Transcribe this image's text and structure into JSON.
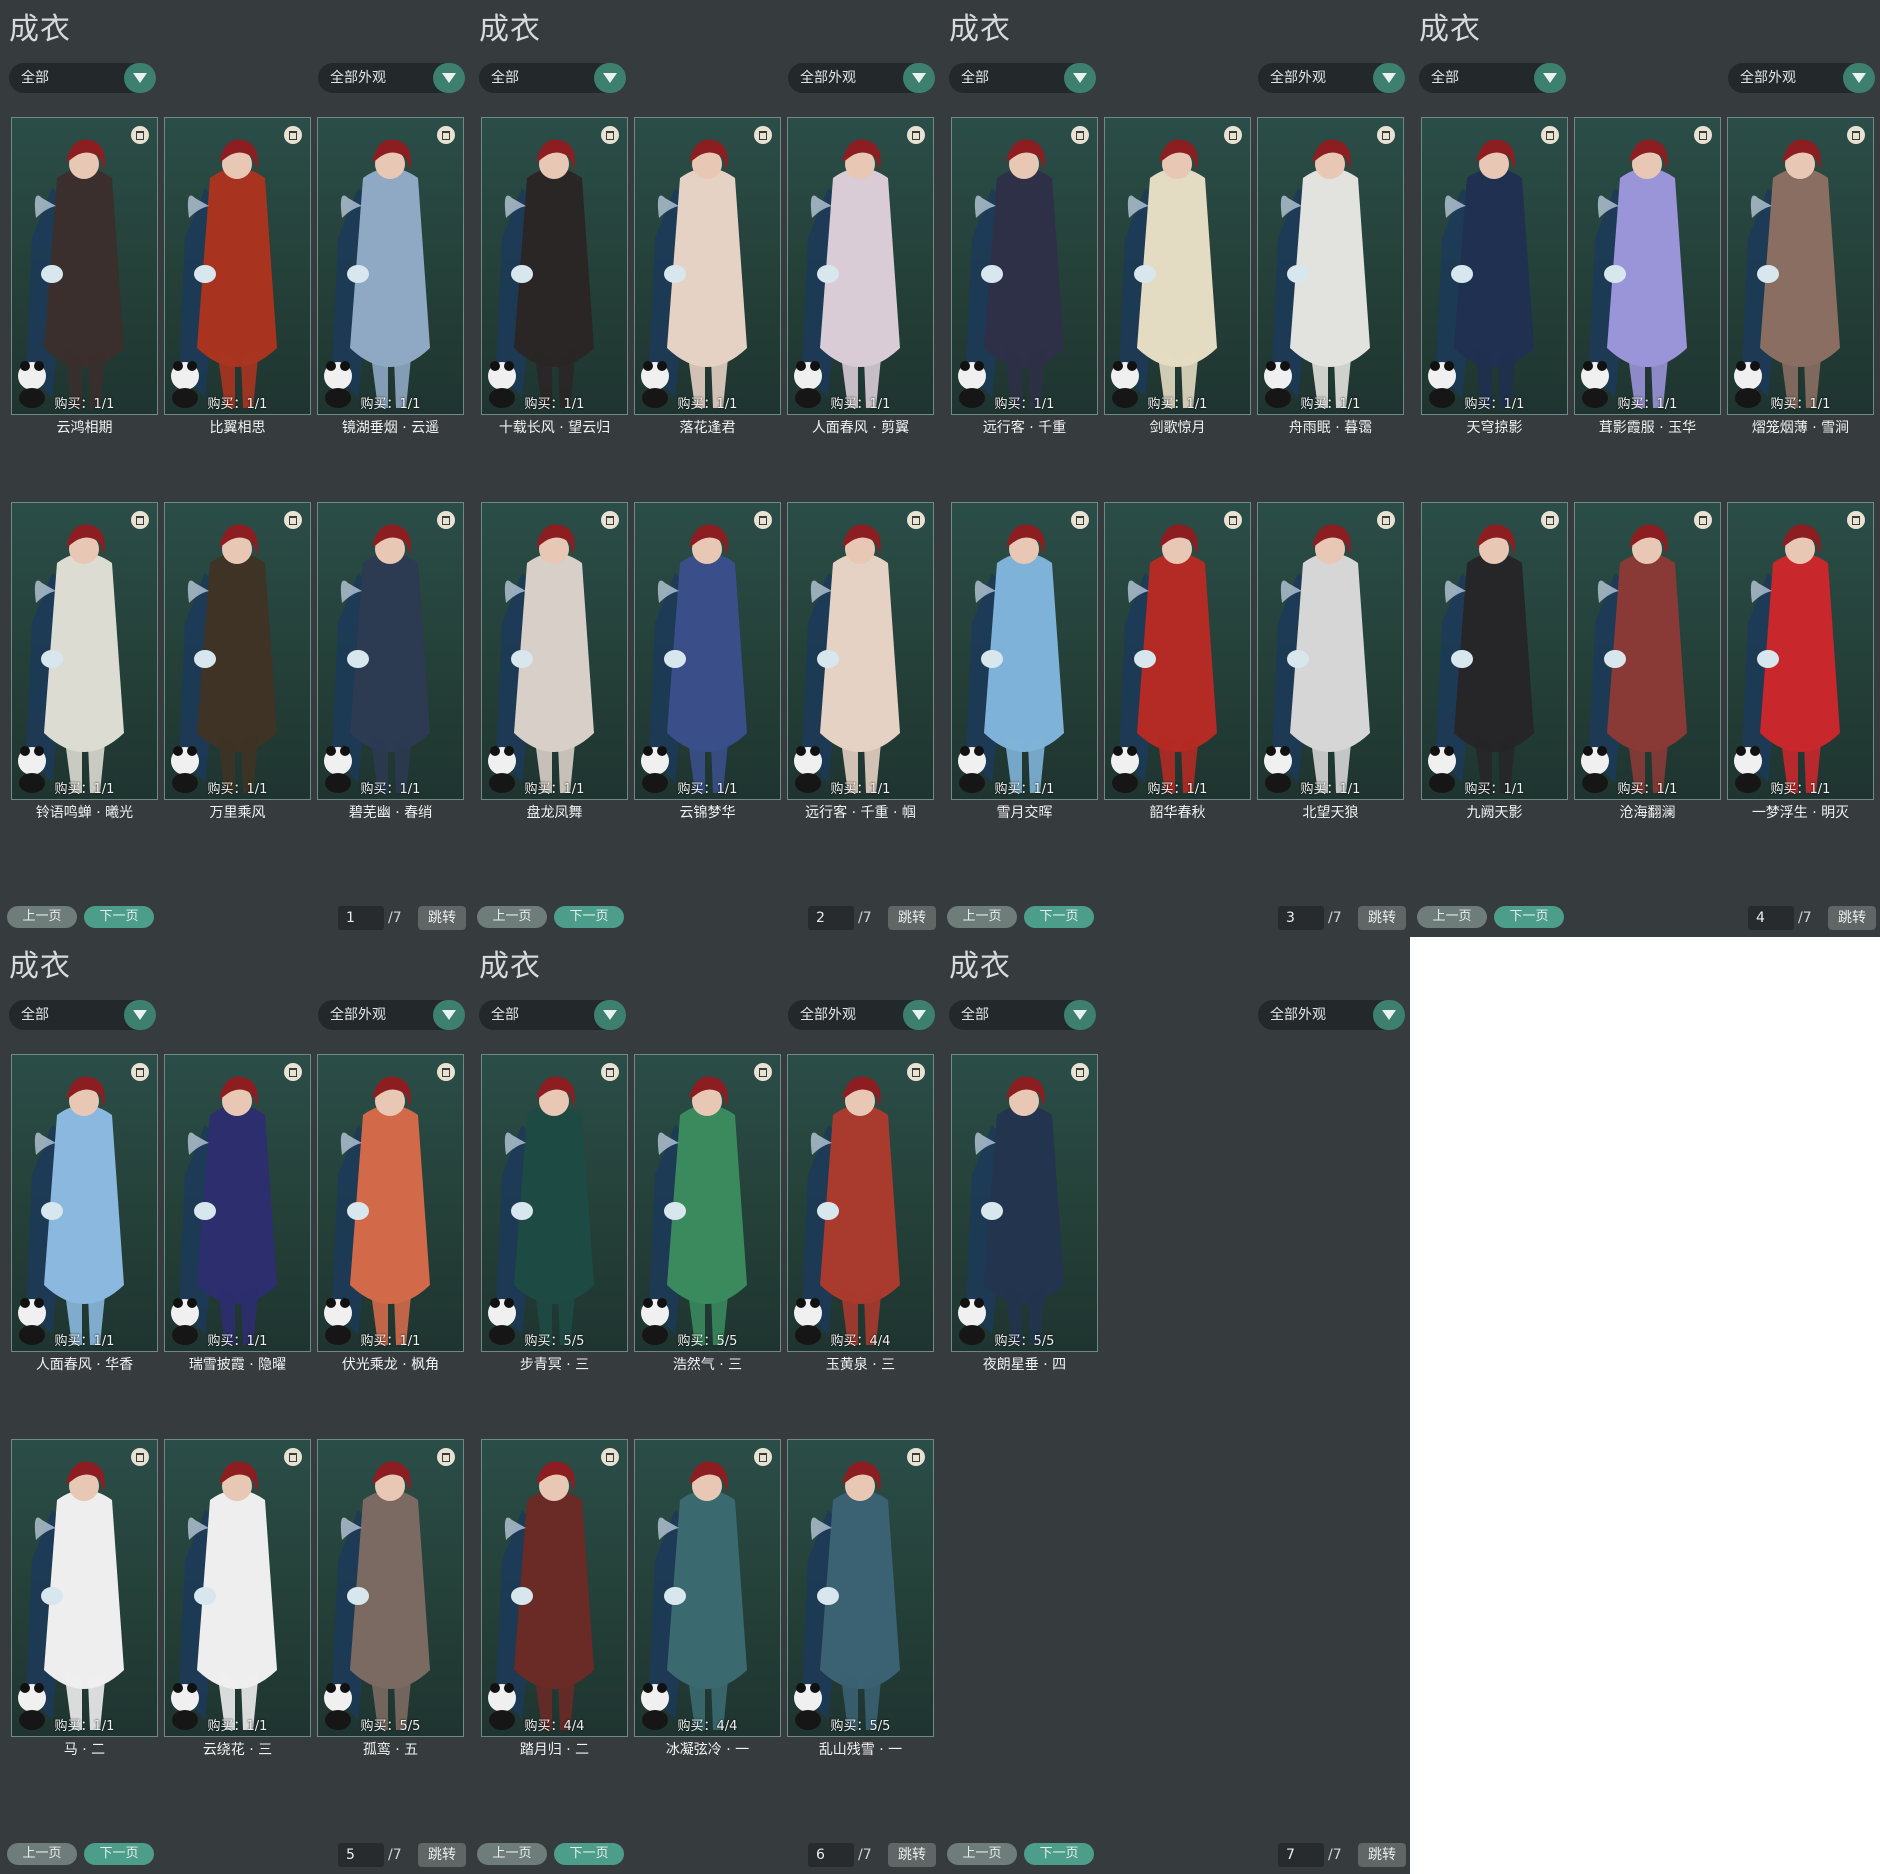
{
  "panels": [
    {
      "title": "成衣",
      "category": "全部",
      "look": "全部外观",
      "page": "1",
      "total": "/7",
      "prev": "上一页",
      "next": "下一页",
      "jump": "跳转",
      "items": [
        {
          "name": "云鸿相期",
          "buy": "购买：1/1",
          "color": "#3a2f2c"
        },
        {
          "name": "比翼相思",
          "buy": "购买：1/1",
          "color": "#a8341f"
        },
        {
          "name": "镜湖垂烟 · 云遥",
          "buy": "购买：1/1",
          "color": "#8fa9c4"
        },
        {
          "name": "铃语鸣蝉 · 曦光",
          "buy": "购买：1/1",
          "color": "#dcdcd2"
        },
        {
          "name": "万里乘风",
          "buy": "购买：1/1",
          "color": "#3e3324"
        },
        {
          "name": "碧芜幽 · 春绡",
          "buy": "购买：1/1",
          "color": "#2c3a52"
        }
      ]
    },
    {
      "title": "成衣",
      "category": "全部",
      "look": "全部外观",
      "page": "2",
      "total": "/7",
      "prev": "上一页",
      "next": "下一页",
      "jump": "跳转",
      "items": [
        {
          "name": "十载长风 · 望云归",
          "buy": "购买：1/1",
          "color": "#2a2626"
        },
        {
          "name": "落花逢君",
          "buy": "购买：1/1",
          "color": "#e6d2c4"
        },
        {
          "name": "人面春风 · 剪翼",
          "buy": "购买：1/1",
          "color": "#d9ccd6"
        },
        {
          "name": "盘龙凤舞",
          "buy": "购买：1/1",
          "color": "#d8cfc8"
        },
        {
          "name": "云锦梦华",
          "buy": "购买：1/1",
          "color": "#3a4f8a"
        },
        {
          "name": "远行客 · 千重 · 帼",
          "buy": "购买：1/1",
          "color": "#e6d2c4"
        }
      ]
    },
    {
      "title": "成衣",
      "category": "全部",
      "look": "全部外观",
      "page": "3",
      "total": "/7",
      "prev": "上一页",
      "next": "下一页",
      "jump": "跳转",
      "items": [
        {
          "name": "远行客 · 千重",
          "buy": "购买：1/1",
          "color": "#2d3046"
        },
        {
          "name": "剑歌惊月",
          "buy": "购买：1/1",
          "color": "#e4dcc2"
        },
        {
          "name": "舟雨眠 · 暮霭",
          "buy": "购买：1/1",
          "color": "#e2e2de"
        },
        {
          "name": "雪月交晖",
          "buy": "购买：1/1",
          "color": "#7fb2d8"
        },
        {
          "name": "韶华春秋",
          "buy": "购买：1/1",
          "color": "#b42a24"
        },
        {
          "name": "北望天狼",
          "buy": "购买：1/1",
          "color": "#d6d6d6"
        }
      ]
    },
    {
      "title": "成衣",
      "category": "全部",
      "look": "全部外观",
      "page": "4",
      "total": "/7",
      "prev": "上一页",
      "next": "下一页",
      "jump": "跳转",
      "items": [
        {
          "name": "天穹掠影",
          "buy": "购买：1/1",
          "color": "#1f3050"
        },
        {
          "name": "茸影霞服 · 玉华",
          "buy": "购买：1/1",
          "color": "#9a94d8"
        },
        {
          "name": "熠笼烟薄 · 雪涧",
          "buy": "购买：1/1",
          "color": "#8a6e62"
        },
        {
          "name": "九阙天影",
          "buy": "购买：1/1",
          "color": "#262628"
        },
        {
          "name": "沧海翻澜",
          "buy": "购买：1/1",
          "color": "#8a3a36"
        },
        {
          "name": "一梦浮生 · 明灭",
          "buy": "购买：1/1",
          "color": "#c8282c"
        }
      ]
    },
    {
      "title": "成衣",
      "category": "全部",
      "look": "全部外观",
      "page": "5",
      "total": "/7",
      "prev": "上一页",
      "next": "下一页",
      "jump": "跳转",
      "items": [
        {
          "name": "人面春风 · 华香",
          "buy": "购买：1/1",
          "color": "#8ab8de"
        },
        {
          "name": "瑞雪披霞 · 隐曜",
          "buy": "购买：1/1",
          "color": "#2c2e6e"
        },
        {
          "name": "伏光乘龙 · 枫角",
          "buy": "购买：1/1",
          "color": "#d26a4a"
        },
        {
          "name": "马 · 二",
          "buy": "购买：1/1",
          "color": "#eeeeee"
        },
        {
          "name": "云绕花 · 三",
          "buy": "购买：1/1",
          "color": "#eeeeee"
        },
        {
          "name": "孤鸾 · 五",
          "buy": "购买：5/5",
          "color": "#7a6a62"
        }
      ]
    },
    {
      "title": "成衣",
      "category": "全部",
      "look": "全部外观",
      "page": "6",
      "total": "/7",
      "prev": "上一页",
      "next": "下一页",
      "jump": "跳转",
      "items": [
        {
          "name": "步青冥 · 三",
          "buy": "购买：5/5",
          "color": "#1e4a44"
        },
        {
          "name": "浩然气 · 三",
          "buy": "购买：5/5",
          "color": "#3a8a5e"
        },
        {
          "name": "玉黄泉 · 三",
          "buy": "购买：4/4",
          "color": "#a83a2e"
        },
        {
          "name": "踏月归 · 二",
          "buy": "购买：4/4",
          "color": "#6a2a26"
        },
        {
          "name": "冰凝弦冷 · 一",
          "buy": "购买：4/4",
          "color": "#3a6a70"
        },
        {
          "name": "乱山残雪 · 一",
          "buy": "购买：5/5",
          "color": "#3a6272"
        }
      ]
    },
    {
      "title": "成衣",
      "category": "全部",
      "look": "全部外观",
      "page": "7",
      "total": "/7",
      "prev": "上一页",
      "next": "下一页",
      "jump": "跳转",
      "items": [
        {
          "name": "夜朗星垂 · 四",
          "buy": "购买：5/5",
          "color": "#22344e"
        }
      ]
    }
  ]
}
